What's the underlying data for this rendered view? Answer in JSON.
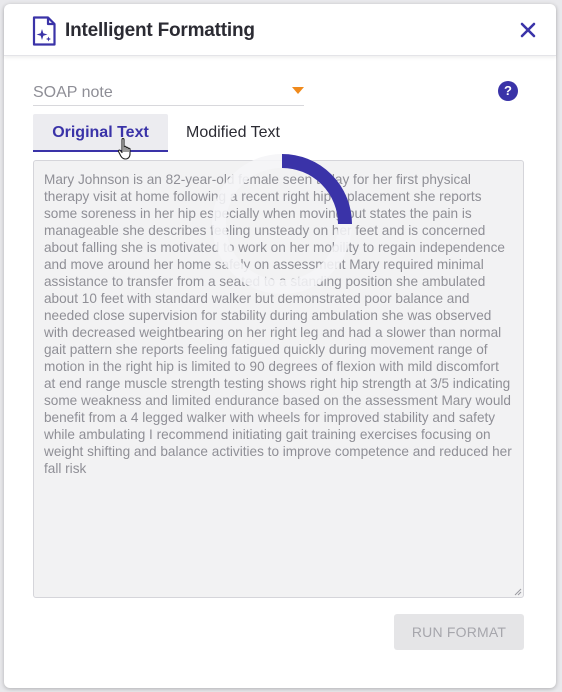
{
  "dialog": {
    "title": "Intelligent Formatting",
    "icon": "document-sparkle-icon",
    "close_icon": "close-icon"
  },
  "format_select": {
    "selected": "SOAP note",
    "caret_color": "#f08a1c"
  },
  "help": {
    "label": "?"
  },
  "tabs": [
    {
      "label": "Original Text",
      "active": true
    },
    {
      "label": "Modified Text",
      "active": false
    }
  ],
  "original_text": "Mary Johnson is an 82-year-old female seen today for her first physical therapy visit at home following a recent right hip replacement she reports some soreness in her hip especially when moving but states the pain is manageable she describes feeling unsteady on her feet and is concerned about falling she is motivated to work on her mobility to regain independence and move around her home safely on assessment Mary required minimal assistance to transfer from a seated to a standing position she ambulated about 10 feet with standard walker but demonstrated poor balance and needed close supervision for stability during ambulation she was observed with decreased weightbearing on her right leg and had a slower than normal gait pattern she reports feeling fatigued quickly during movement range of motion in the right hip is limited to 90 degrees of flexion with mild discomfort at end range muscle strength testing shows right hip strength at 3/5 indicating some weakness and limited endurance based on the assessment Mary would benefit from a 4 legged walker with wheels for improved stability and safety while ambulating I recommend initiating gait training exercises focusing on weight shifting and balance activities to improve competence and reduced her fall risk",
  "run_button": {
    "label": "RUN FORMAT",
    "enabled": false
  },
  "colors": {
    "accent": "#3a33a8",
    "caret": "#f08a1c",
    "text_area_bg": "#f2f2f3",
    "disabled_button_bg": "#e5e5e7"
  }
}
